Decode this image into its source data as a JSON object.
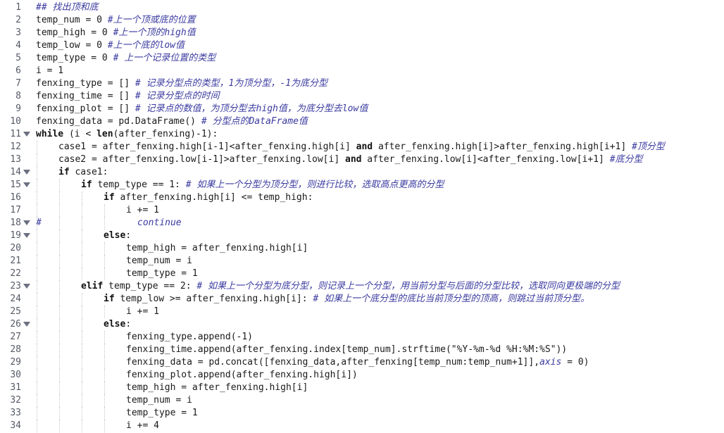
{
  "editor": {
    "lines": [
      {
        "n": "1",
        "gutter_comment": "",
        "fold": false,
        "indent": 0,
        "guides": 0,
        "tokens": [
          {
            "t": "## 找出顶和底",
            "c": "cm"
          }
        ]
      },
      {
        "n": "2",
        "gutter_comment": "",
        "fold": false,
        "indent": 0,
        "guides": 0,
        "tokens": [
          {
            "t": "temp_num = 0 ",
            "c": "tx"
          },
          {
            "t": "#上一个顶或底的位置",
            "c": "cm"
          }
        ]
      },
      {
        "n": "3",
        "gutter_comment": "",
        "fold": false,
        "indent": 0,
        "guides": 0,
        "tokens": [
          {
            "t": "temp_high = 0 ",
            "c": "tx"
          },
          {
            "t": "#上一个顶的high值",
            "c": "cm"
          }
        ]
      },
      {
        "n": "4",
        "gutter_comment": "",
        "fold": false,
        "indent": 0,
        "guides": 0,
        "tokens": [
          {
            "t": "temp_low = 0 ",
            "c": "tx"
          },
          {
            "t": "#上一个底的low值",
            "c": "cm"
          }
        ]
      },
      {
        "n": "5",
        "gutter_comment": "",
        "fold": false,
        "indent": 0,
        "guides": 0,
        "tokens": [
          {
            "t": "temp_type = 0 ",
            "c": "tx"
          },
          {
            "t": "# 上一个记录位置的类型",
            "c": "cm"
          }
        ]
      },
      {
        "n": "6",
        "gutter_comment": "",
        "fold": false,
        "indent": 0,
        "guides": 0,
        "tokens": [
          {
            "t": "i = 1",
            "c": "tx"
          }
        ]
      },
      {
        "n": "7",
        "gutter_comment": "",
        "fold": false,
        "indent": 0,
        "guides": 0,
        "tokens": [
          {
            "t": "fenxing_type = [] ",
            "c": "tx"
          },
          {
            "t": "# 记录分型点的类型，1为顶分型，-1为底分型",
            "c": "cm"
          }
        ]
      },
      {
        "n": "8",
        "gutter_comment": "",
        "fold": false,
        "indent": 0,
        "guides": 0,
        "tokens": [
          {
            "t": "fenxing_time = [] ",
            "c": "tx"
          },
          {
            "t": "# 记录分型点的时间",
            "c": "cm"
          }
        ]
      },
      {
        "n": "9",
        "gutter_comment": "",
        "fold": false,
        "indent": 0,
        "guides": 0,
        "tokens": [
          {
            "t": "fenxing_plot = [] ",
            "c": "tx"
          },
          {
            "t": "# 记录点的数值，为顶分型去high值，为底分型去low值",
            "c": "cm"
          }
        ]
      },
      {
        "n": "10",
        "gutter_comment": "",
        "fold": false,
        "indent": 0,
        "guides": 0,
        "tokens": [
          {
            "t": "fenxing_data = pd.DataFrame() ",
            "c": "tx"
          },
          {
            "t": "# 分型点的DataFrame值",
            "c": "cm"
          }
        ]
      },
      {
        "n": "11",
        "gutter_comment": "",
        "fold": true,
        "indent": 0,
        "guides": 0,
        "tokens": [
          {
            "t": "while",
            "c": "kw"
          },
          {
            "t": " (i < ",
            "c": "tx"
          },
          {
            "t": "len",
            "c": "kw"
          },
          {
            "t": "(after_fenxing)-1):",
            "c": "tx"
          }
        ]
      },
      {
        "n": "12",
        "gutter_comment": "",
        "fold": false,
        "indent": 1,
        "guides": 1,
        "tokens": [
          {
            "t": "case1 = after_fenxing.high[i-1]<after_fenxing.high[i] ",
            "c": "tx"
          },
          {
            "t": "and",
            "c": "kw"
          },
          {
            "t": " after_fenxing.high[i]>after_fenxing.high[i+1] ",
            "c": "tx"
          },
          {
            "t": "#顶分型",
            "c": "cm"
          }
        ]
      },
      {
        "n": "13",
        "gutter_comment": "",
        "fold": false,
        "indent": 1,
        "guides": 1,
        "tokens": [
          {
            "t": "case2 = after_fenxing.low[i-1]>after_fenxing.low[i] ",
            "c": "tx"
          },
          {
            "t": "and",
            "c": "kw"
          },
          {
            "t": " after_fenxing.low[i]<after_fenxing.low[i+1] ",
            "c": "tx"
          },
          {
            "t": "#底分型",
            "c": "cm"
          }
        ]
      },
      {
        "n": "14",
        "gutter_comment": "",
        "fold": true,
        "indent": 1,
        "guides": 1,
        "tokens": [
          {
            "t": "if",
            "c": "kw"
          },
          {
            "t": " case1:",
            "c": "tx"
          }
        ]
      },
      {
        "n": "15",
        "gutter_comment": "",
        "fold": true,
        "indent": 2,
        "guides": 2,
        "tokens": [
          {
            "t": "if",
            "c": "kw"
          },
          {
            "t": " temp_type == 1: ",
            "c": "tx"
          },
          {
            "t": "# 如果上一个分型为顶分型，则进行比较，选取高点更高的分型",
            "c": "cm"
          }
        ]
      },
      {
        "n": "16",
        "gutter_comment": "",
        "fold": false,
        "indent": 3,
        "guides": 3,
        "tokens": [
          {
            "t": "if",
            "c": "kw"
          },
          {
            "t": " after_fenxing.high[i] <= temp_high:",
            "c": "tx"
          }
        ]
      },
      {
        "n": "17",
        "gutter_comment": "",
        "fold": false,
        "indent": 4,
        "guides": 4,
        "tokens": [
          {
            "t": "i += 1",
            "c": "tx"
          }
        ]
      },
      {
        "n": "18",
        "gutter_comment": "#",
        "fold": true,
        "indent": 4.5,
        "guides": 4,
        "tokens": [
          {
            "t": "continue",
            "c": "cm"
          }
        ]
      },
      {
        "n": "19",
        "gutter_comment": "",
        "fold": true,
        "indent": 3,
        "guides": 3,
        "tokens": [
          {
            "t": "else",
            "c": "kw"
          },
          {
            "t": ":",
            "c": "tx"
          }
        ]
      },
      {
        "n": "20",
        "gutter_comment": "",
        "fold": false,
        "indent": 4,
        "guides": 4,
        "tokens": [
          {
            "t": "temp_high = after_fenxing.high[i]",
            "c": "tx"
          }
        ]
      },
      {
        "n": "21",
        "gutter_comment": "",
        "fold": false,
        "indent": 4,
        "guides": 4,
        "tokens": [
          {
            "t": "temp_num = i",
            "c": "tx"
          }
        ]
      },
      {
        "n": "22",
        "gutter_comment": "",
        "fold": false,
        "indent": 4,
        "guides": 4,
        "tokens": [
          {
            "t": "temp_type = 1",
            "c": "tx"
          }
        ]
      },
      {
        "n": "23",
        "gutter_comment": "",
        "fold": true,
        "indent": 2,
        "guides": 2,
        "tokens": [
          {
            "t": "elif",
            "c": "kw"
          },
          {
            "t": " temp_type == 2: ",
            "c": "tx"
          },
          {
            "t": "# 如果上一个分型为底分型，则记录上一个分型，用当前分型与后面的分型比较，选取同向更极端的分型",
            "c": "cm"
          }
        ]
      },
      {
        "n": "24",
        "gutter_comment": "",
        "fold": false,
        "indent": 3,
        "guides": 3,
        "tokens": [
          {
            "t": "if",
            "c": "kw"
          },
          {
            "t": " temp_low >= after_fenxing.high[i]: ",
            "c": "tx"
          },
          {
            "t": "# 如果上一个底分型的底比当前顶分型的顶高，则跳过当前顶分型。",
            "c": "cm"
          }
        ]
      },
      {
        "n": "25",
        "gutter_comment": "",
        "fold": false,
        "indent": 4,
        "guides": 4,
        "tokens": [
          {
            "t": "i += 1",
            "c": "tx"
          }
        ]
      },
      {
        "n": "26",
        "gutter_comment": "",
        "fold": true,
        "indent": 3,
        "guides": 3,
        "tokens": [
          {
            "t": "else",
            "c": "kw"
          },
          {
            "t": ":",
            "c": "tx"
          }
        ]
      },
      {
        "n": "27",
        "gutter_comment": "",
        "fold": false,
        "indent": 4,
        "guides": 4,
        "tokens": [
          {
            "t": "fenxing_type.append(-1)",
            "c": "tx"
          }
        ]
      },
      {
        "n": "28",
        "gutter_comment": "",
        "fold": false,
        "indent": 4,
        "guides": 4,
        "tokens": [
          {
            "t": "fenxing_time.append(after_fenxing.index[temp_num].strftime(\"%Y-%m-%d %H:%M:%S\"))",
            "c": "tx"
          }
        ]
      },
      {
        "n": "29",
        "gutter_comment": "",
        "fold": false,
        "indent": 4,
        "guides": 4,
        "tokens": [
          {
            "t": "fenxing_data = pd.concat([fenxing_data,after_fenxing[temp_num:temp_num+1]],",
            "c": "tx"
          },
          {
            "t": "axis",
            "c": "cm"
          },
          {
            "t": " = 0)",
            "c": "tx"
          }
        ]
      },
      {
        "n": "30",
        "gutter_comment": "",
        "fold": false,
        "indent": 4,
        "guides": 4,
        "tokens": [
          {
            "t": "fenxing_plot.append(after_fenxing.high[i])",
            "c": "tx"
          }
        ]
      },
      {
        "n": "31",
        "gutter_comment": "",
        "fold": false,
        "indent": 4,
        "guides": 4,
        "tokens": [
          {
            "t": "temp_high = after_fenxing.high[i]",
            "c": "tx"
          }
        ]
      },
      {
        "n": "32",
        "gutter_comment": "",
        "fold": false,
        "indent": 4,
        "guides": 4,
        "tokens": [
          {
            "t": "temp_num = i",
            "c": "tx"
          }
        ]
      },
      {
        "n": "33",
        "gutter_comment": "",
        "fold": false,
        "indent": 4,
        "guides": 4,
        "tokens": [
          {
            "t": "temp_type = 1",
            "c": "tx"
          }
        ]
      },
      {
        "n": "34",
        "gutter_comment": "",
        "fold": false,
        "indent": 4,
        "guides": 4,
        "tokens": [
          {
            "t": "i += 4",
            "c": "tx"
          }
        ]
      }
    ]
  }
}
